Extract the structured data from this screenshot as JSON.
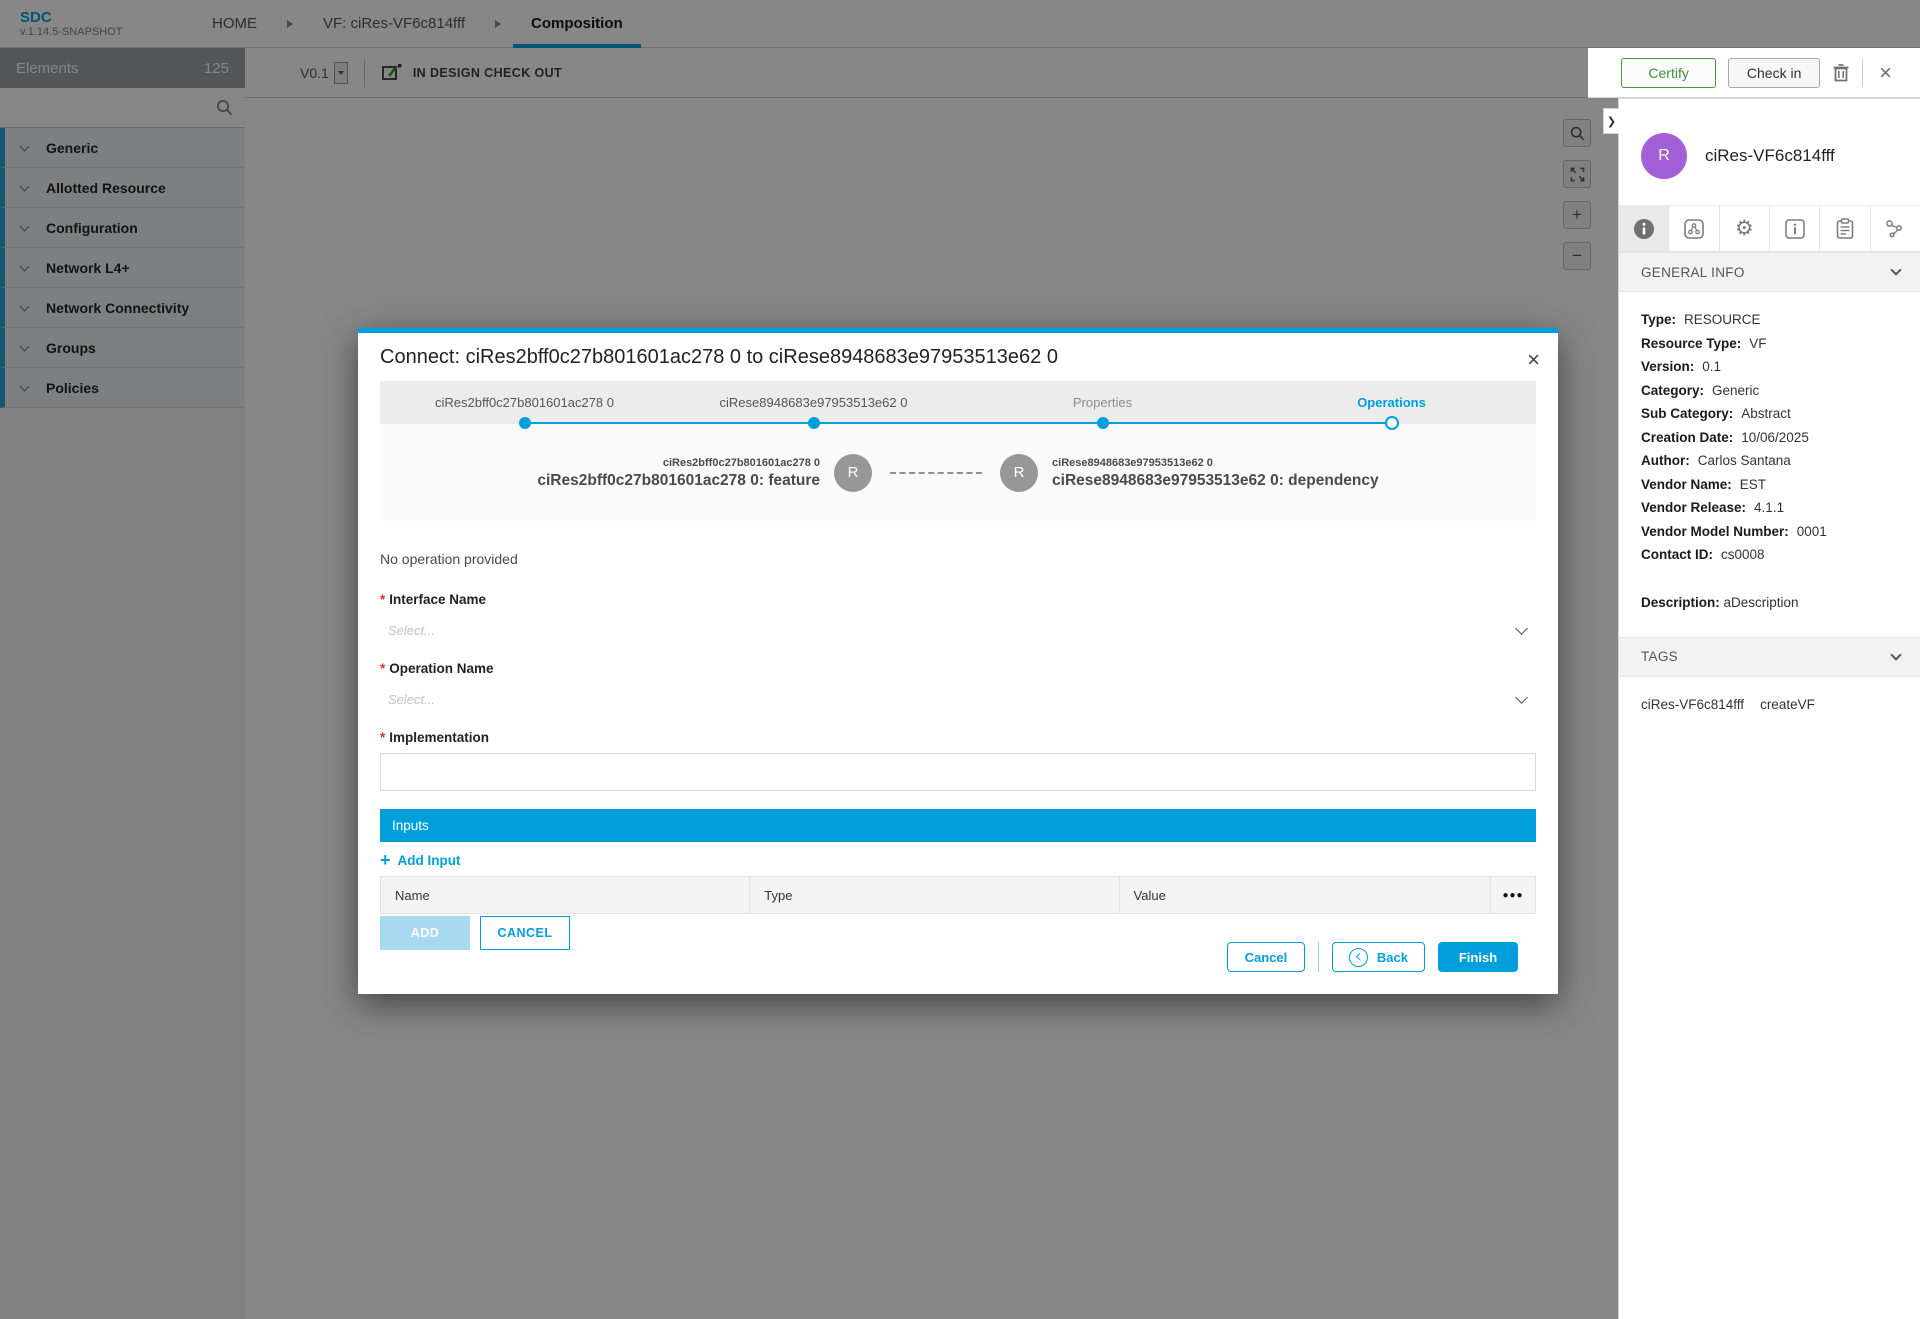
{
  "accent": "#009fdb",
  "icons": {
    "close": "×",
    "plus": "+",
    "minus": "−",
    "menu_dots": "●●●",
    "gear": "⚙",
    "collapse_right": "❯",
    "required_mark": "*"
  },
  "header": {
    "logo_title": "SDC",
    "logo_version": "v.1.14.5-SNAPSHOT",
    "breadcrumbs": [
      {
        "label": "HOME"
      },
      {
        "label": "VF: ciRes-VF6c814fff"
      },
      {
        "label": "Composition"
      }
    ]
  },
  "toolbar": {
    "version": "V0.1",
    "state_label": "IN DESIGN CHECK OUT",
    "certify_label": "Certify",
    "checkin_label": "Check in"
  },
  "sidebar": {
    "title": "Elements",
    "count": "125",
    "search_placeholder": "",
    "items": [
      {
        "label": "Generic"
      },
      {
        "label": "Allotted Resource"
      },
      {
        "label": "Configuration"
      },
      {
        "label": "Network L4+"
      },
      {
        "label": "Network Connectivity"
      },
      {
        "label": "Groups"
      },
      {
        "label": "Policies"
      }
    ]
  },
  "panel": {
    "avatar_letter": "R",
    "title": "ciRes-VF6c814fff",
    "general_info": {
      "title": "GENERAL INFO",
      "rows": [
        {
          "label": "Type:",
          "value": "RESOURCE"
        },
        {
          "label": "Resource Type:",
          "value": "VF"
        },
        {
          "label": "Version:",
          "value": "0.1"
        },
        {
          "label": "Category:",
          "value": "Generic"
        },
        {
          "label": "Sub Category:",
          "value": "Abstract"
        },
        {
          "label": "Creation Date:",
          "value": "10/06/2025"
        },
        {
          "label": "Author:",
          "value": "Carlos Santana"
        },
        {
          "label": "Vendor Name:",
          "value": "EST"
        },
        {
          "label": "Vendor Release:",
          "value": "4.1.1"
        },
        {
          "label": "Vendor Model Number:",
          "value": "0001"
        },
        {
          "label": "Contact ID:",
          "value": "cs0008"
        }
      ],
      "description_label": "Description:",
      "description_value": " aDescription"
    },
    "tags": {
      "title": "TAGS",
      "items": [
        "ciRes-VF6c814fff",
        "createVF"
      ]
    }
  },
  "modal": {
    "title": "Connect: ciRes2bff0c27b801601ac278 0 to ciRese8948683e97953513e62 0",
    "steps": [
      {
        "label": "ciRes2bff0c27b801601ac278 0"
      },
      {
        "label": "ciRese8948683e97953513e62 0"
      },
      {
        "label": "Properties"
      },
      {
        "label": "Operations"
      }
    ],
    "preview": {
      "source_small": "ciRes2bff0c27b801601ac278 0",
      "source_big": "ciRes2bff0c27b801601ac278 0: feature",
      "target_small": "ciRese8948683e97953513e62 0",
      "target_big": "ciRese8948683e97953513e62 0: dependency",
      "node_letter": "R"
    },
    "no_operation": "No operation provided",
    "fields": {
      "interface_label": "Interface Name",
      "operation_label": "Operation Name",
      "implementation_label": "Implementation",
      "select_placeholder": "Select...",
      "implementation_value": ""
    },
    "inputs": {
      "header": "Inputs",
      "add_label": "Add Input",
      "columns": [
        "Name",
        "Type",
        "Value"
      ],
      "add_button": "ADD",
      "cancel_button": "CANCEL"
    },
    "footer": {
      "cancel": "Cancel",
      "back": "Back",
      "finish": "Finish"
    }
  }
}
